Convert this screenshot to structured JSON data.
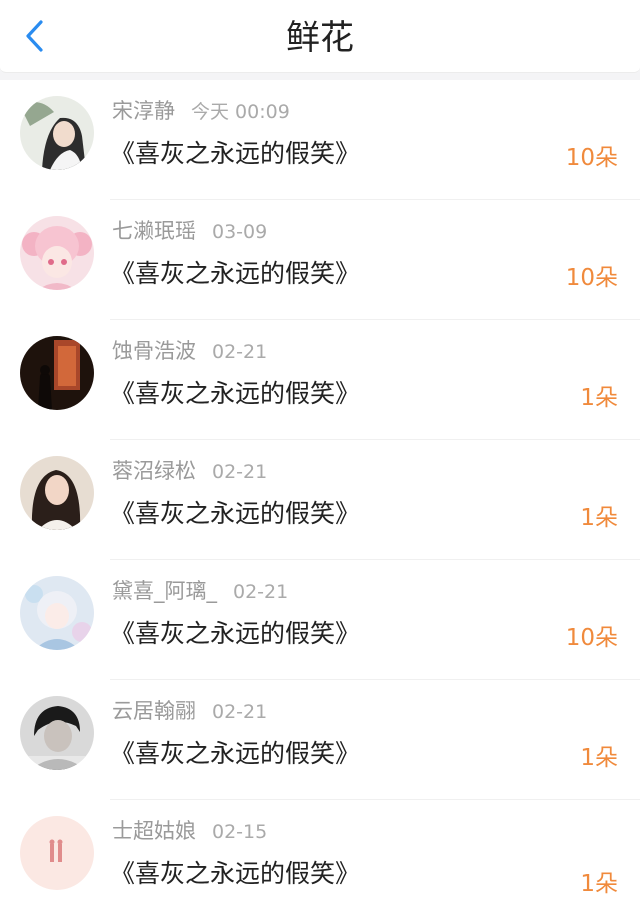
{
  "header": {
    "title": "鲜花"
  },
  "colors": {
    "accent": "#2a8cf0",
    "amount": "#f08a3c"
  },
  "items": [
    {
      "name": "宋淳静",
      "time": "今天 00:09",
      "book": "《喜灰之永远的假笑》",
      "amount": "10朵"
    },
    {
      "name": "七濑珉瑶",
      "time": "03-09",
      "book": "《喜灰之永远的假笑》",
      "amount": "10朵"
    },
    {
      "name": "蚀骨浩波",
      "time": "02-21",
      "book": "《喜灰之永远的假笑》",
      "amount": "1朵"
    },
    {
      "name": "蓉沼绿松",
      "time": "02-21",
      "book": "《喜灰之永远的假笑》",
      "amount": "1朵"
    },
    {
      "name": "黛喜_阿璃_",
      "time": "02-21",
      "book": "《喜灰之永远的假笑》",
      "amount": "10朵"
    },
    {
      "name": "云居翰翮",
      "time": "02-21",
      "book": "《喜灰之永远的假笑》",
      "amount": "1朵"
    },
    {
      "name": "士超姑娘",
      "time": "02-15",
      "book": "《喜灰之永远的假笑》",
      "amount": "1朵"
    }
  ]
}
